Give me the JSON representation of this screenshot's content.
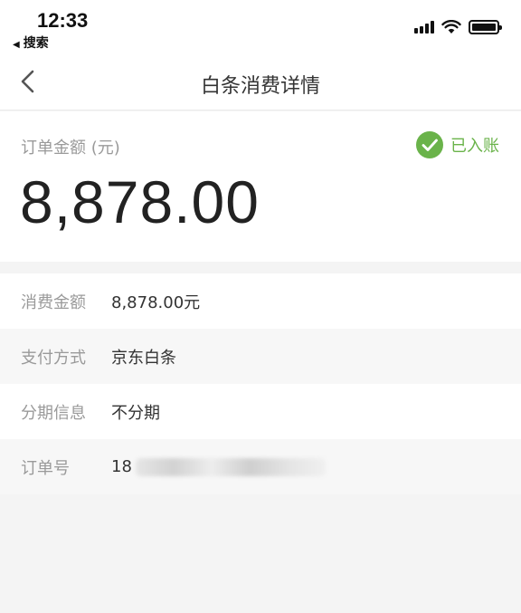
{
  "status_bar": {
    "time": "12:33",
    "back_app": "搜索"
  },
  "nav": {
    "title": "白条消费详情"
  },
  "amount": {
    "label": "订单金额 (元)",
    "value": "8,878.00",
    "status": "已入账",
    "status_color": "#6ab34a"
  },
  "details": [
    {
      "key": "消费金额",
      "value": "8,878.00元"
    },
    {
      "key": "支付方式",
      "value": "京东白条"
    },
    {
      "key": "分期信息",
      "value": "不分期"
    },
    {
      "key": "订单号",
      "value": "18"
    }
  ],
  "icons": {
    "back": "chevron-left-icon",
    "status": "check-circle-icon",
    "signal": "cellular-signal-icon",
    "wifi": "wifi-icon",
    "battery": "battery-icon"
  }
}
